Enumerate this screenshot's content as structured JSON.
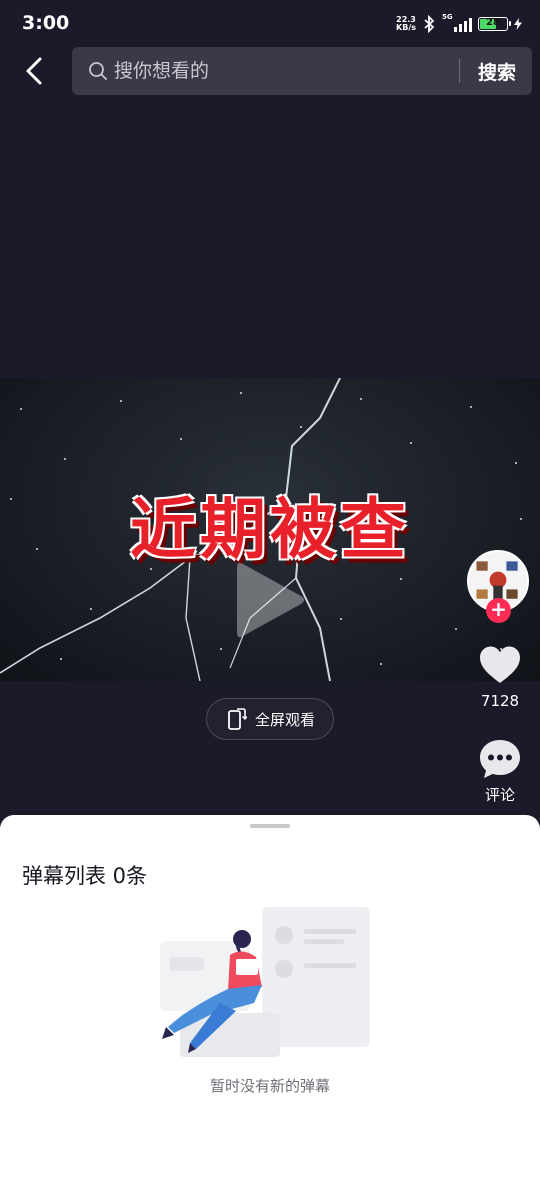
{
  "status_bar": {
    "time": "3:00",
    "net_speed_value": "22.3",
    "net_speed_unit": "KB/s",
    "signal_label": "5G",
    "battery_level": "28",
    "icons": [
      "bluetooth-icon",
      "signal-icon",
      "battery-icon",
      "charging-icon"
    ]
  },
  "search": {
    "placeholder": "搜你想看的",
    "button_label": "搜索"
  },
  "video": {
    "title_text": "近期被查"
  },
  "actions": {
    "like_count": "7128",
    "comment_label": "评论",
    "follow_symbol": "+"
  },
  "fullscreen": {
    "label": "全屏观看"
  },
  "danmaku_sheet": {
    "title": "弹幕列表 0条",
    "empty_message": "暂时没有新的弹幕"
  },
  "colors": {
    "background": "#1b1a2a",
    "accent_red": "#fe2c55",
    "sheet_bg": "#ffffff"
  }
}
